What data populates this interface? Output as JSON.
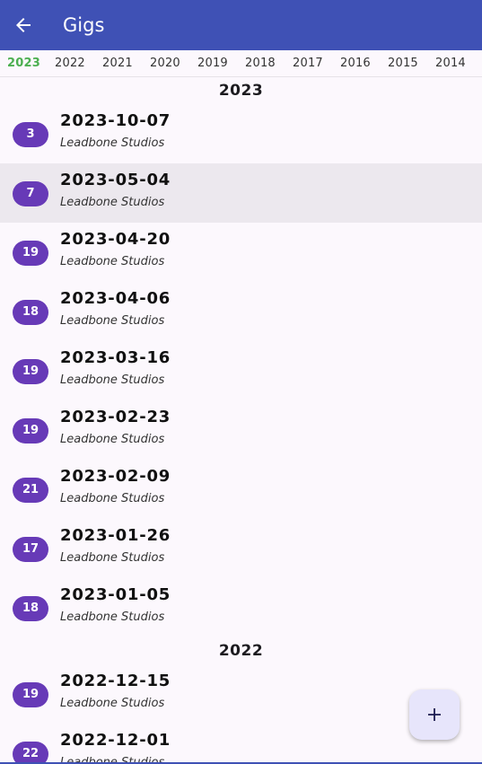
{
  "app": {
    "title": "Gigs"
  },
  "year_tabs": [
    {
      "label": "2023",
      "active": true
    },
    {
      "label": "2022"
    },
    {
      "label": "2021"
    },
    {
      "label": "2020"
    },
    {
      "label": "2019"
    },
    {
      "label": "2018"
    },
    {
      "label": "2017"
    },
    {
      "label": "2016"
    },
    {
      "label": "2015"
    },
    {
      "label": "2014"
    }
  ],
  "sections": [
    {
      "year": "2023",
      "gigs": [
        {
          "count": "3",
          "date": "2023-10-07",
          "venue": "Leadbone Studios"
        },
        {
          "count": "7",
          "date": "2023-05-04",
          "venue": "Leadbone Studios",
          "highlighted": true
        },
        {
          "count": "19",
          "date": "2023-04-20",
          "venue": "Leadbone Studios"
        },
        {
          "count": "18",
          "date": "2023-04-06",
          "venue": "Leadbone Studios"
        },
        {
          "count": "19",
          "date": "2023-03-16",
          "venue": "Leadbone Studios"
        },
        {
          "count": "19",
          "date": "2023-02-23",
          "venue": "Leadbone Studios"
        },
        {
          "count": "21",
          "date": "2023-02-09",
          "venue": "Leadbone Studios"
        },
        {
          "count": "17",
          "date": "2023-01-26",
          "venue": "Leadbone Studios"
        },
        {
          "count": "18",
          "date": "2023-01-05",
          "venue": "Leadbone Studios"
        }
      ]
    },
    {
      "year": "2022",
      "gigs": [
        {
          "count": "19",
          "date": "2022-12-15",
          "venue": "Leadbone Studios"
        },
        {
          "count": "22",
          "date": "2022-12-01",
          "venue": "Leadbone Studios"
        }
      ]
    }
  ],
  "fab": {
    "icon": "plus-icon"
  },
  "colors": {
    "app_bar": "#3f51b5",
    "active_tab": "#4caf50",
    "badge": "#673ab7",
    "fab": "#e7e5fb"
  }
}
